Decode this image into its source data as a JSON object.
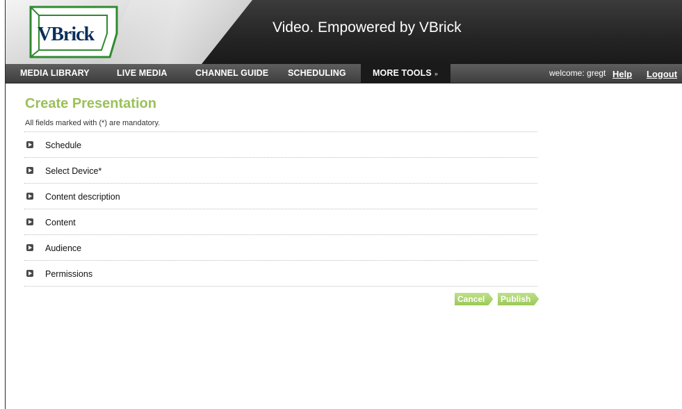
{
  "header": {
    "logo_text": "VBrick",
    "tagline": "Video. Empowered by VBrick"
  },
  "nav": {
    "items": [
      {
        "label": "MEDIA LIBRARY"
      },
      {
        "label": "LIVE MEDIA"
      },
      {
        "label": "CHANNEL GUIDE"
      },
      {
        "label": "SCHEDULING"
      },
      {
        "label": "MORE TOOLS"
      }
    ],
    "more_tools_arrow": "»",
    "welcome": "welcome: gregt",
    "help_label": "Help",
    "logout_label": "Logout"
  },
  "page": {
    "title": "Create Presentation",
    "mandatory_note": "All fields marked with (*) are mandatory.",
    "sections": [
      {
        "label": "Schedule"
      },
      {
        "label": "Select Device*"
      },
      {
        "label": "Content description"
      },
      {
        "label": "Content"
      },
      {
        "label": "Audience"
      },
      {
        "label": "Permissions"
      }
    ],
    "cancel_label": "Cancel",
    "publish_label": "Publish"
  },
  "colors": {
    "title_green": "#9bc05a",
    "button_green": "#a8d063",
    "nav_bg": "#4a4a4a",
    "logo_blue": "#0b2f5c",
    "logo_green": "#2f8a2f"
  }
}
